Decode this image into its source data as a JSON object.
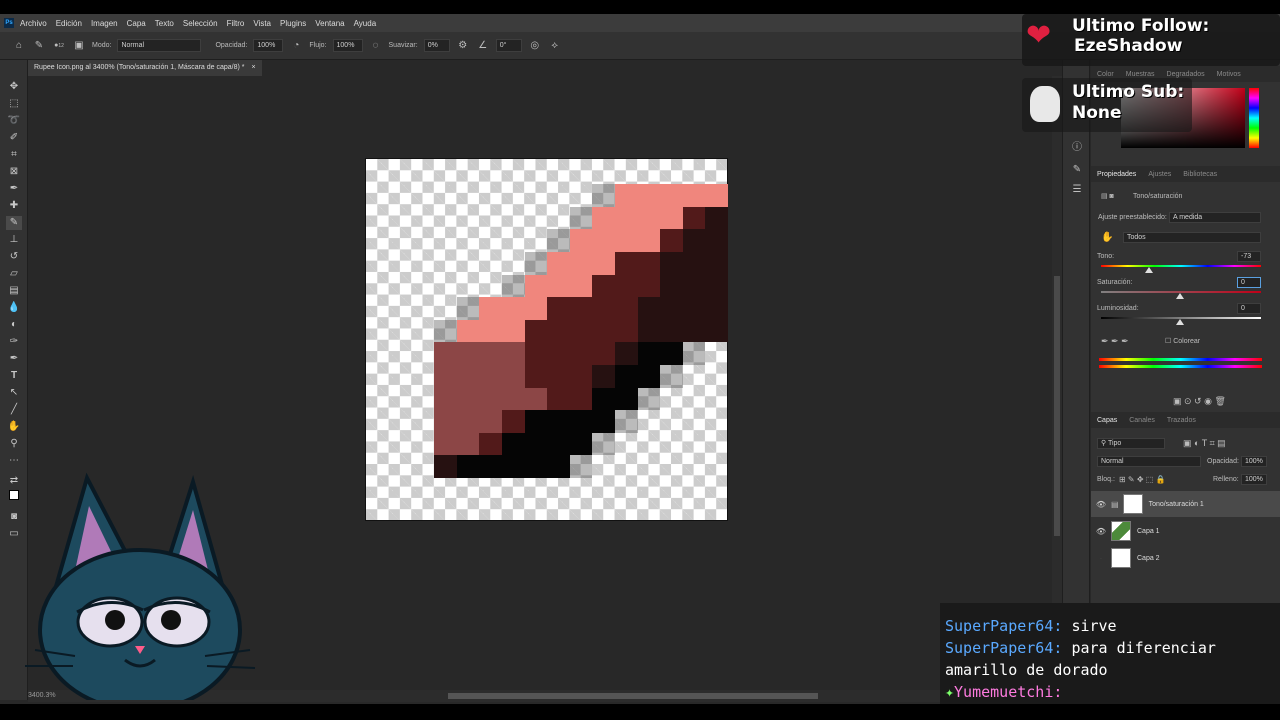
{
  "menu": [
    "Archivo",
    "Edición",
    "Imagen",
    "Capa",
    "Texto",
    "Selección",
    "Filtro",
    "Vista",
    "Plugins",
    "Ventana",
    "Ayuda"
  ],
  "options": {
    "mode_label": "Modo:",
    "mode_value": "Normal",
    "opacity_label": "Opacidad:",
    "opacity_value": "100%",
    "flow_label": "Flujo:",
    "flow_value": "100%",
    "smooth_label": "Suavizar:",
    "smooth_value": "0%",
    "angle_value": "0°",
    "brush_size": "12"
  },
  "document": {
    "tab_title": "Rupee Icon.png al 3400% (Tono/saturación 1, Máscara de capa/8) *",
    "zoom_status": "3400.3%"
  },
  "color_panel": {
    "tabs": [
      "Color",
      "Muestras",
      "Degradados",
      "Motivos"
    ]
  },
  "properties": {
    "tabs": [
      "Propiedades",
      "Ajustes",
      "Bibliotecas"
    ],
    "layer_type": "Tono/saturación",
    "preset_label": "Ajuste preestablecido:",
    "preset_value": "A medida",
    "channel_value": "Todos",
    "hue_label": "Tono:",
    "hue_value": "-73",
    "saturation_label": "Saturación:",
    "saturation_value": "0",
    "lightness_label": "Luminosidad:",
    "lightness_value": "0",
    "colorize_label": "Colorear",
    "hue_fraction": 0.3
  },
  "layers": {
    "tabs": [
      "Capas",
      "Canales",
      "Trazados"
    ],
    "filter_label": "Tipo",
    "blend_mode": "Normal",
    "opacity_label": "Opacidad:",
    "opacity_value": "100%",
    "lock_label": "Bloq.:",
    "fill_label": "Relleno:",
    "fill_value": "100%",
    "items": [
      {
        "name": "Tono/saturación 1",
        "visible": true,
        "selected": true
      },
      {
        "name": "Capa 1",
        "visible": true,
        "selected": false
      },
      {
        "name": "Capa 2",
        "visible": false,
        "selected": false
      }
    ]
  },
  "overlay": {
    "follow_label": "Ultimo Follow:",
    "follow_name": "EzeShadow",
    "sub_label": "Ultimo Sub:",
    "sub_name": "None"
  },
  "chat": [
    {
      "user": "SuperPaper64:",
      "message": "sirve"
    },
    {
      "user": "SuperPaper64:",
      "message": "para diferenciar amarillo de dorado"
    },
    {
      "user": "Yumemuetchi:",
      "message": ""
    }
  ],
  "colors": {
    "light": "#f0867d",
    "mid": "#8c4646",
    "dark": "#521a1a",
    "darker": "#261111",
    "black": "#050505",
    "shadow": "#3d3d3d"
  }
}
